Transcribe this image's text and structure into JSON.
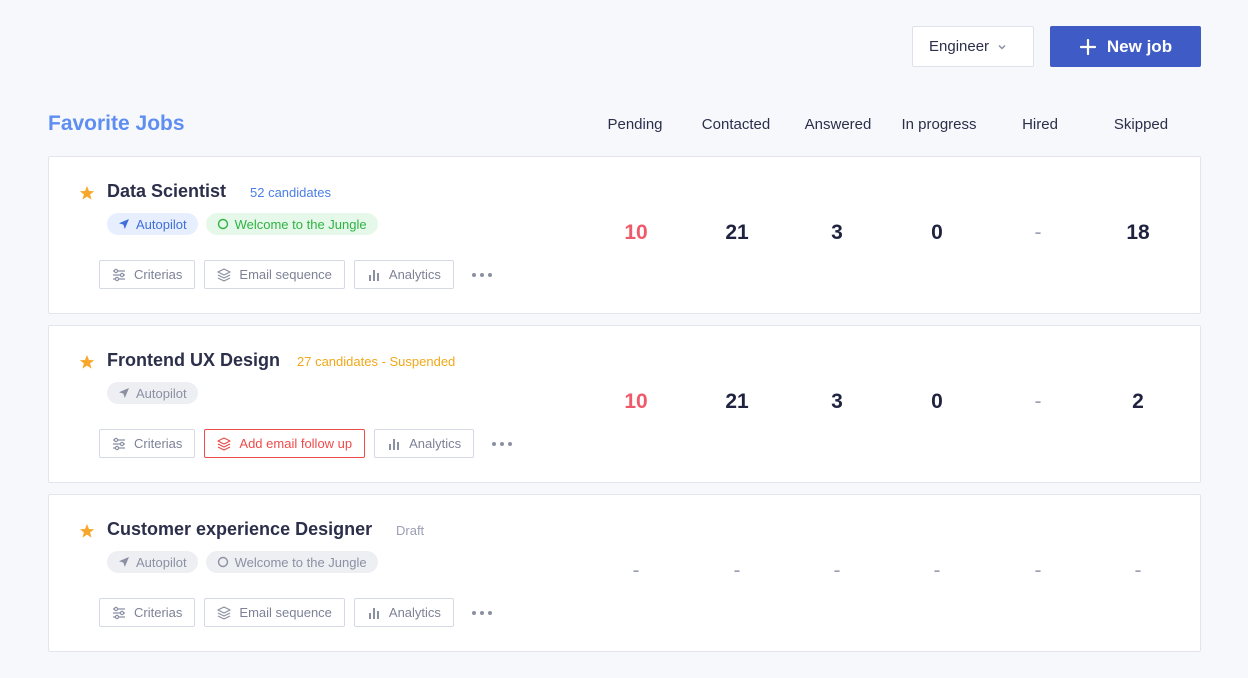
{
  "toolbar": {
    "filter_value": "Engineer",
    "new_job_label": "New job"
  },
  "section": {
    "title": "Favorite Jobs",
    "columns": [
      "Pending",
      "Contacted",
      "Answered",
      "In progress",
      "Hired",
      "Skipped"
    ]
  },
  "colors": {
    "accent": "#3f5bc6",
    "title_blue": "#5e8ef1",
    "star": "#f7a72a",
    "pending_red": "#ef5a6a",
    "suspended_orange": "#f0a818",
    "success_green": "#2fb344",
    "alert_red": "#ee4b4b"
  },
  "jobs": [
    {
      "title": "Data Scientist",
      "meta": "52 candidates",
      "tags": [
        "Autopilot",
        "Welcome to the Jungle"
      ],
      "actions": [
        "Criterias",
        "Email sequence",
        "Analytics"
      ],
      "stats": [
        "10",
        "21",
        "3",
        "0",
        "-",
        "18"
      ]
    },
    {
      "title": "Frontend UX Design",
      "meta": "27 candidates - Suspended",
      "tags": [
        "Autopilot"
      ],
      "actions": [
        "Criterias",
        "Add email follow up",
        "Analytics"
      ],
      "stats": [
        "10",
        "21",
        "3",
        "0",
        "-",
        "2"
      ]
    },
    {
      "title": "Customer experience Designer",
      "meta": "Draft",
      "tags": [
        "Autopilot",
        "Welcome to the Jungle"
      ],
      "actions": [
        "Criterias",
        "Email sequence",
        "Analytics"
      ],
      "stats": [
        "-",
        "-",
        "-",
        "-",
        "-",
        "-"
      ]
    }
  ]
}
